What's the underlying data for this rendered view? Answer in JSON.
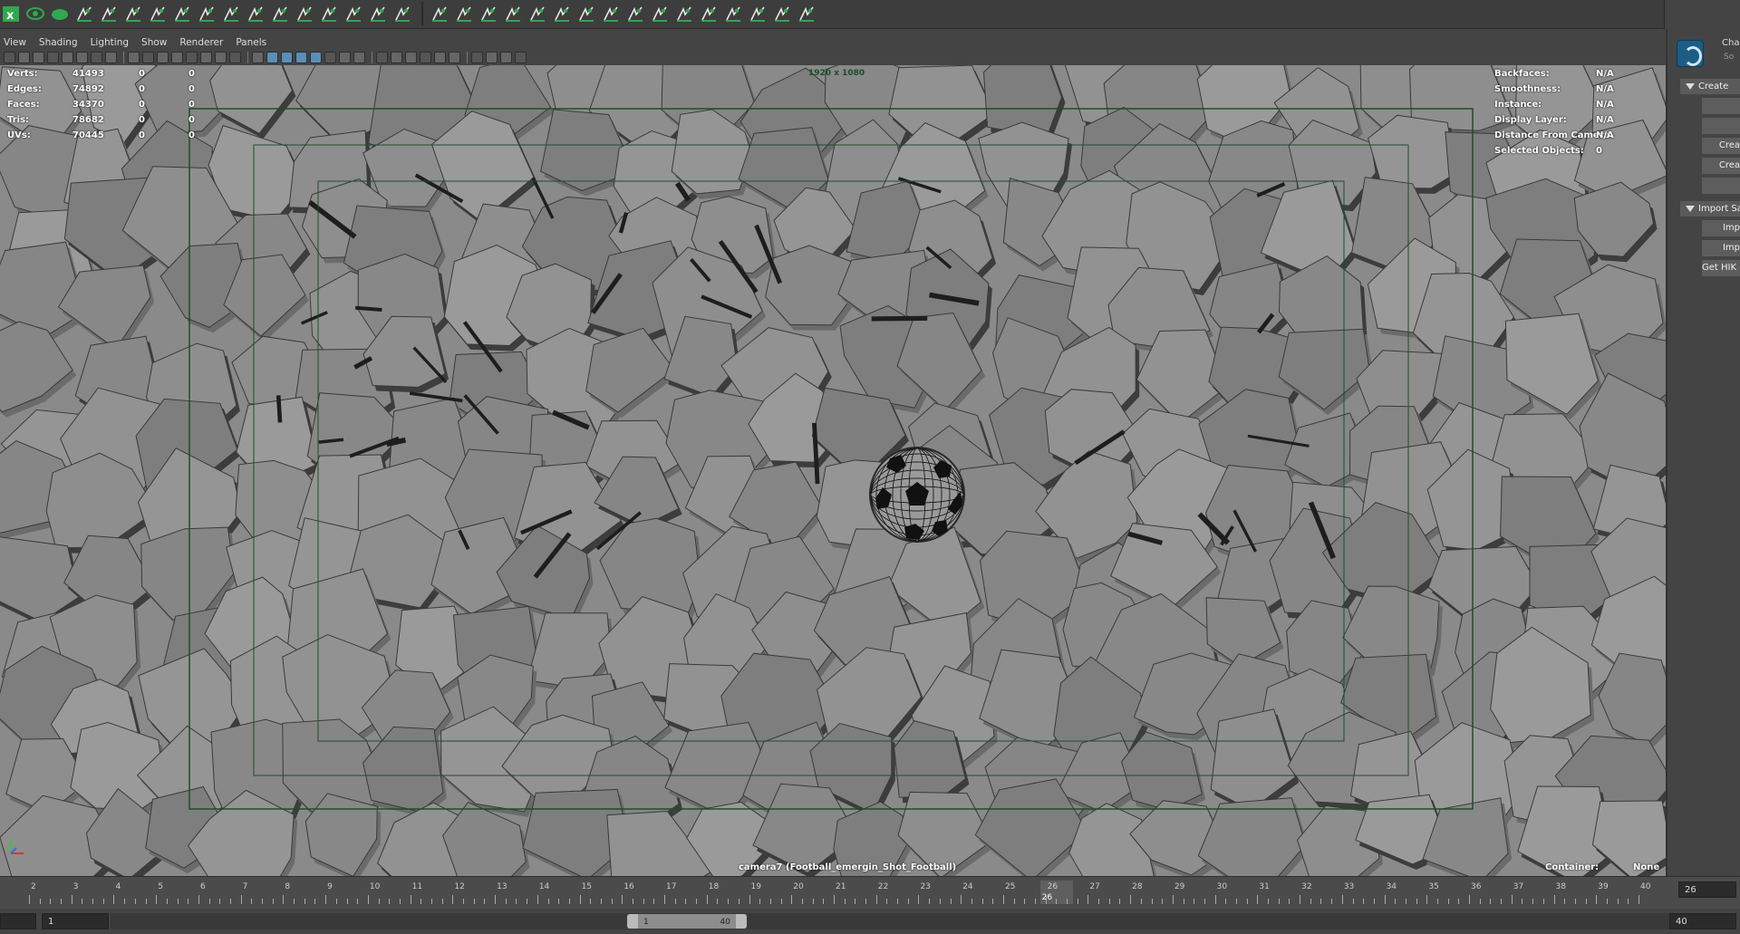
{
  "window": {
    "title": ""
  },
  "shelf": {
    "icon_count": 38,
    "accent_color": "#2fa84f",
    "icons": [
      "excel-icon",
      "eye-icon",
      "blob-icon",
      "joint-icon",
      "ik-handle-icon",
      "joint-tool-icon",
      "locator-icon",
      "cluster-icon",
      "hair-icon",
      "layers-icon",
      "skin-icon",
      "brush-icon",
      "curve-icon",
      "ik-spline-icon",
      "spline-icon",
      "deformer-icon",
      "bar-chart-icon",
      "bone-add-icon",
      "paint-weights-icon",
      "weight-add-icon",
      "weight-tool-icon",
      "weight-tool-icon",
      "mirror-weights-icon",
      "copy-weights-icon",
      "smooth-weights-icon",
      "prune-weights-icon",
      "hammer-weights-icon",
      "paint-icon",
      "blend-icon",
      "wrap-icon",
      "cage-icon",
      "spark-icon",
      "sculpt-icon"
    ]
  },
  "viewport_menu": {
    "items": [
      "View",
      "Shading",
      "Lighting",
      "Show",
      "Renderer",
      "Panels"
    ]
  },
  "viewport_toolbar": {
    "icon_count": 34
  },
  "hud": {
    "left_rows": [
      {
        "label": "Verts:",
        "v1": "41493",
        "v2": "0",
        "v3": "0"
      },
      {
        "label": "Edges:",
        "v1": "74892",
        "v2": "0",
        "v3": "0"
      },
      {
        "label": "Faces:",
        "v1": "34370",
        "v2": "0",
        "v3": "0"
      },
      {
        "label": "Tris:",
        "v1": "78682",
        "v2": "0",
        "v3": "0"
      },
      {
        "label": "UVs:",
        "v1": "70445",
        "v2": "0",
        "v3": "0"
      }
    ],
    "right_rows": [
      {
        "label": "Backfaces:",
        "value": "N/A"
      },
      {
        "label": "Smoothness:",
        "value": "N/A"
      },
      {
        "label": "Instance:",
        "value": "N/A"
      },
      {
        "label": "Display Layer:",
        "value": "N/A"
      },
      {
        "label": "Distance From Camera:",
        "value": "N/A"
      },
      {
        "label": "Selected Objects:",
        "value": "0"
      }
    ],
    "resolution": "1920 x 1080",
    "camera": "camera7 (Football_emergin_Shot_Football)",
    "container_label": "Container:",
    "container_value": "None",
    "gate_color": "#1f4d2a"
  },
  "sidebar": {
    "title": "Chara",
    "subtitle": "So",
    "sections": [
      {
        "label": "Create",
        "buttons": [
          "",
          "",
          "Crea",
          "Crea",
          ""
        ]
      },
      {
        "label": "Import Sam",
        "buttons": [
          "Imp",
          "Imp",
          "Get HIK a"
        ]
      }
    ]
  },
  "timeline": {
    "start_tick": 2,
    "end_tick": 40,
    "current_frame": "26",
    "labels": [
      "2",
      "3",
      "4",
      "5",
      "6",
      "7",
      "8",
      "9",
      "10",
      "11",
      "12",
      "13",
      "14",
      "15",
      "16",
      "17",
      "18",
      "19",
      "20",
      "21",
      "22",
      "23",
      "24",
      "25",
      "26",
      "27",
      "28",
      "29",
      "30",
      "31",
      "32",
      "33",
      "34",
      "35",
      "36",
      "37",
      "38",
      "39",
      "40"
    ],
    "current_frame_field": "26"
  },
  "range": {
    "start_field": "",
    "anim_start": "1",
    "handle_start": "1",
    "handle_end": "40",
    "end_field": "40"
  }
}
